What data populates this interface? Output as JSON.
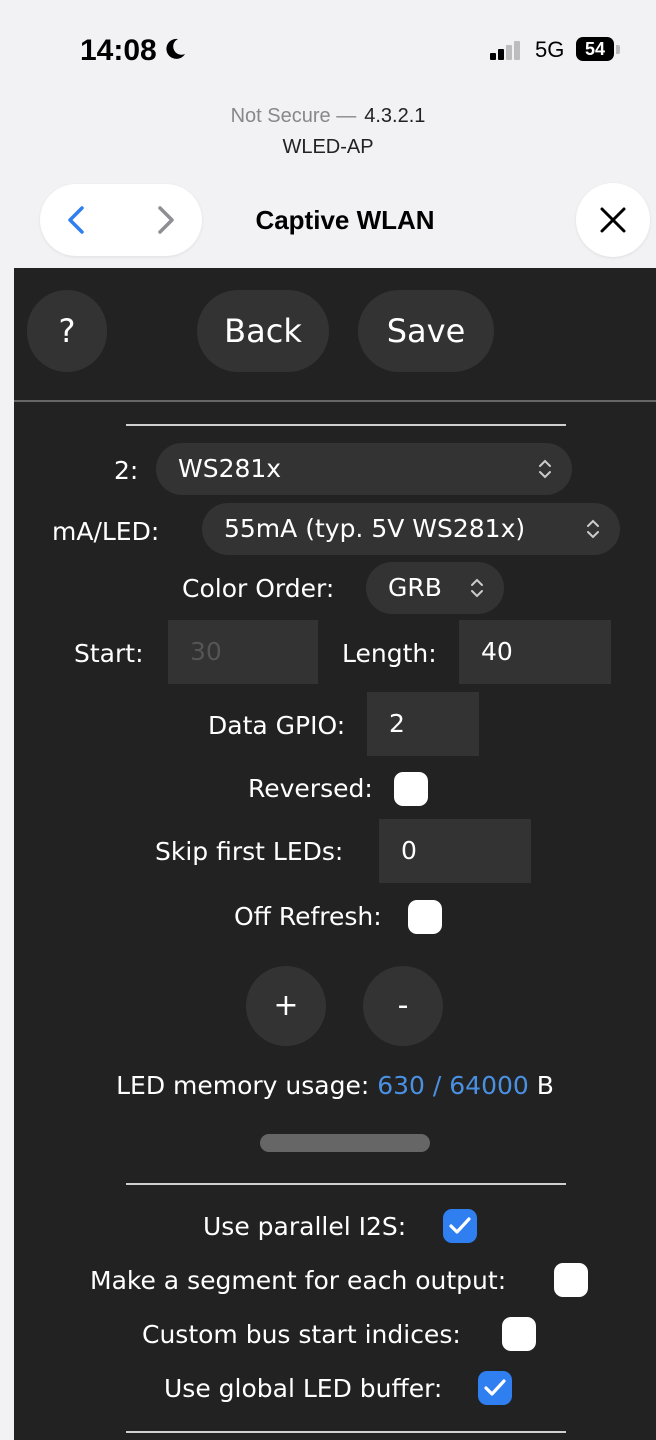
{
  "status_bar": {
    "time": "14:08",
    "network": "5G",
    "battery": "54",
    "moon_icon": "moon-icon",
    "signal_icon": "cellular-signal-icon"
  },
  "url_bar": {
    "security": "Not Secure —",
    "address": "4.3.2.1",
    "site": "WLED-AP"
  },
  "browser_nav": {
    "title": "Captive WLAN",
    "back_icon": "chevron-left-icon",
    "forward_icon": "chevron-right-icon",
    "close_icon": "close-icon"
  },
  "toolbar": {
    "help_label": "?",
    "back_label": "Back",
    "save_label": "Save"
  },
  "led_output": {
    "index_label": "2:",
    "type_value": "WS281x",
    "ma_label": "mA/LED:",
    "ma_value": "55mA (typ. 5V WS281x)",
    "color_order_label": "Color Order:",
    "color_order_value": "GRB",
    "start_label": "Start:",
    "start_value": "30",
    "length_label": "Length:",
    "length_value": "40",
    "gpio_label": "Data GPIO:",
    "gpio_value": "2",
    "reversed_label": "Reversed:",
    "reversed_checked": false,
    "skip_label": "Skip first LEDs:",
    "skip_value": "0",
    "off_refresh_label": "Off Refresh:",
    "off_refresh_checked": false,
    "add_label": "+",
    "remove_label": "-"
  },
  "memory": {
    "label": "LED memory usage:",
    "value": "630 / 64000",
    "unit": "B"
  },
  "options": {
    "parallel_i2s_label": "Use parallel I2S:",
    "parallel_i2s_checked": true,
    "segment_label": "Make a segment for each output:",
    "segment_checked": false,
    "custom_bus_label": "Custom bus start indices:",
    "custom_bus_checked": false,
    "global_buffer_label": "Use global LED buffer:",
    "global_buffer_checked": true
  },
  "colors": {
    "page_background": "#222222",
    "control_background": "#333333",
    "accent_blue": "#2f7ff0",
    "memory_value_blue": "#4a90e2",
    "browser_chrome": "#f2f2f4"
  }
}
